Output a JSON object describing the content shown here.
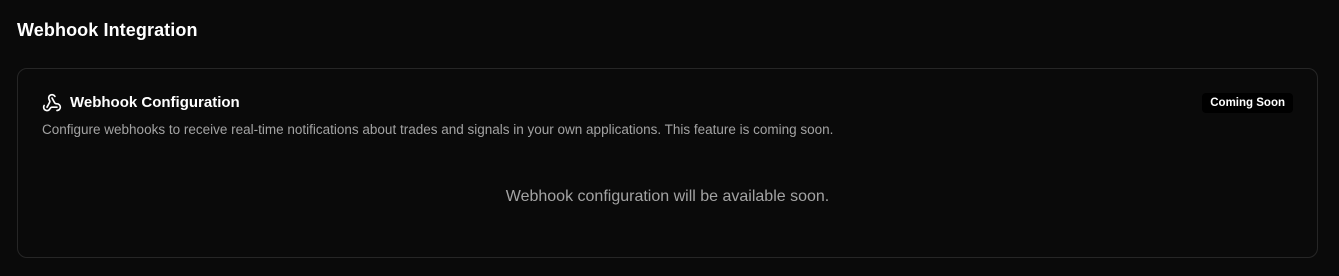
{
  "page": {
    "title": "Webhook Integration"
  },
  "card": {
    "icon": "webhook-icon",
    "title": "Webhook Configuration",
    "description": "Configure webhooks to receive real-time notifications about trades and signals in your own applications. This feature is coming soon.",
    "badge": "Coming Soon",
    "empty_message": "Webhook configuration will be available soon."
  },
  "colors": {
    "background": "#0a0a0a",
    "card_border": "#262626",
    "muted_text": "#a3a3a3",
    "badge_bg": "#000000"
  }
}
